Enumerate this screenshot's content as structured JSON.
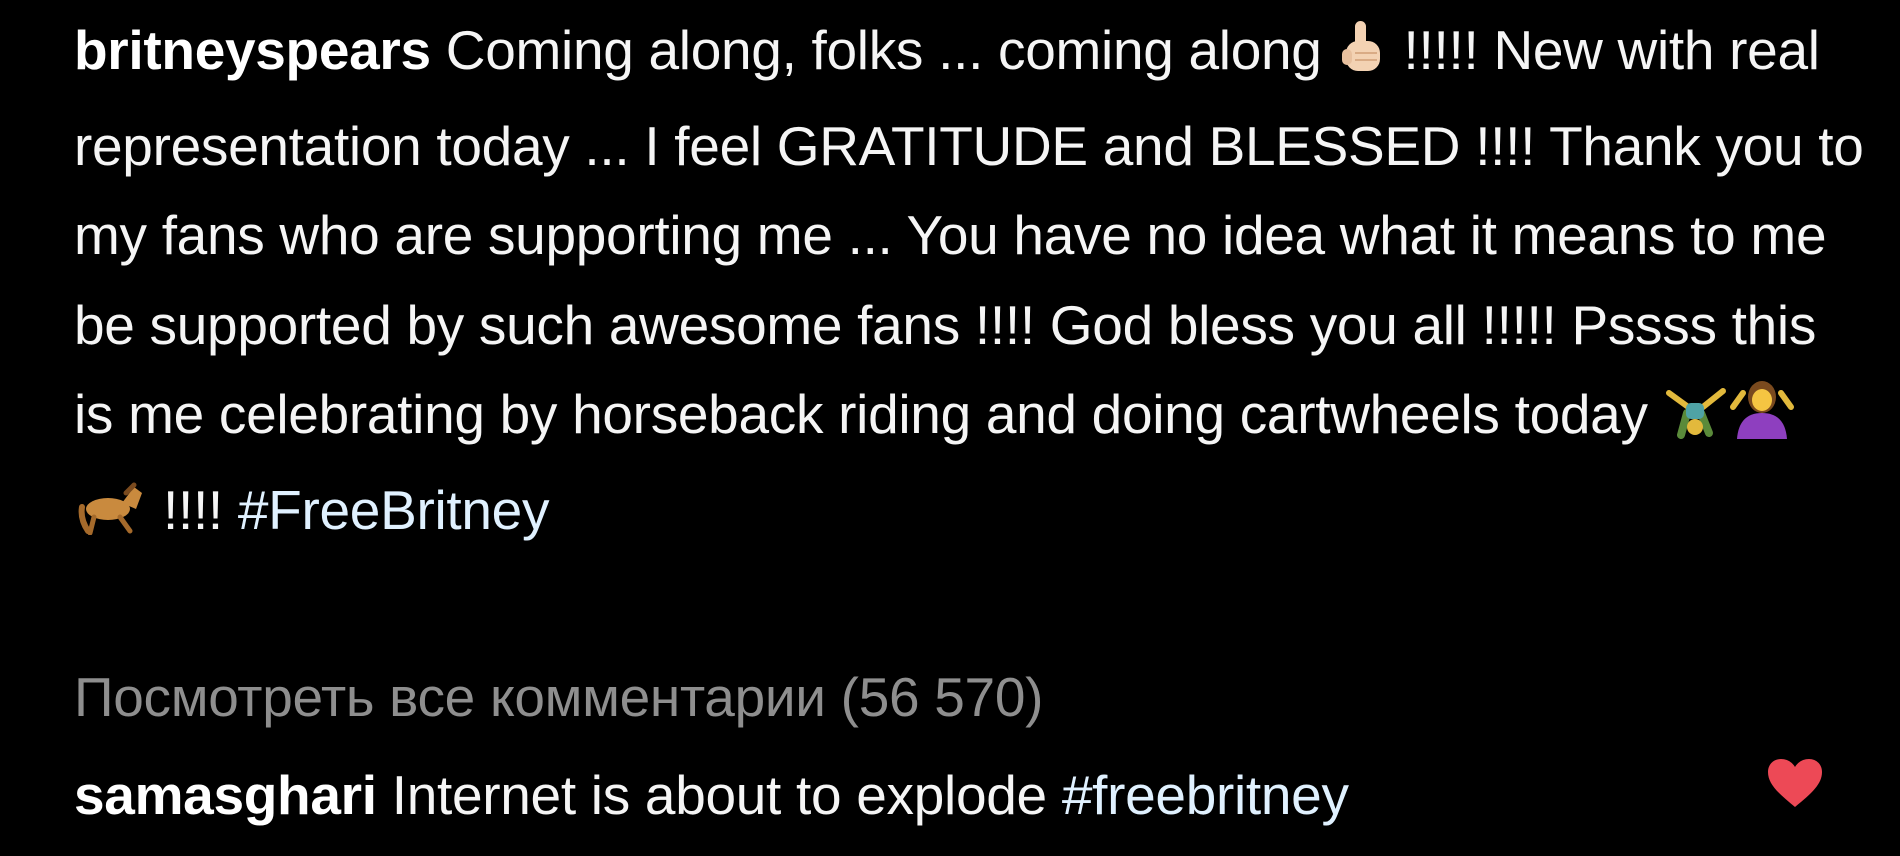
{
  "post": {
    "username": "britneyspears",
    "caption_part1": " Coming along, folks ... coming along ",
    "caption_part2": " !!!!! New with real representation today ... I feel GRATITUDE and BLESSED !!!! Thank you to my fans who are supporting me ... You have no idea what it means to me be supported by such awesome fans !!!! God bless you all !!!!! Pssss this is me celebrating by horseback riding and doing cartwheels today ",
    "caption_part3": " !!!! ",
    "hashtag": "#FreeBritney",
    "emojis": [
      "pointing-up-hand",
      "person-cartwheeling",
      "woman-shrugging",
      "horse"
    ]
  },
  "view_all_comments": "Посмотреть все комментарии (56 570)",
  "comment": {
    "username": "samasghari",
    "text": " Internet is about to explode ",
    "hashtag": "#freebritney",
    "liked": true,
    "heart_color": "#ed4956"
  }
}
